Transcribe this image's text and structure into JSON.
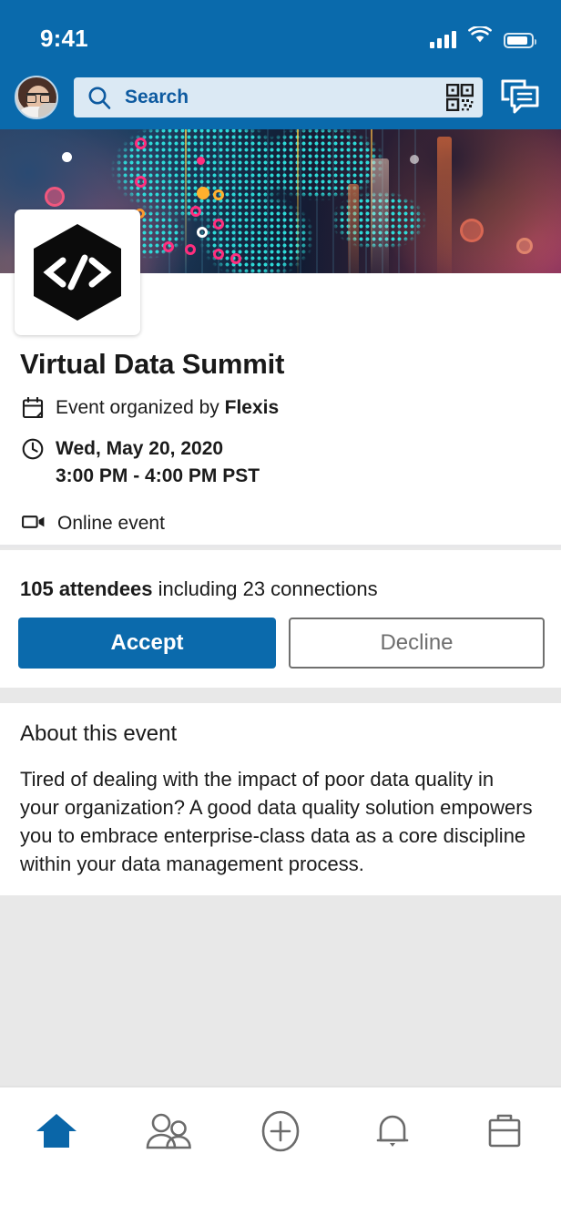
{
  "status_bar": {
    "time": "9:41",
    "signal_icon": "cellular-signal-icon",
    "wifi_icon": "wifi-icon",
    "battery_icon": "battery-icon"
  },
  "header": {
    "avatar_label": "profile-avatar",
    "search": {
      "placeholder": "Search",
      "search_icon": "search-icon",
      "qr_icon": "qr-code-icon"
    },
    "messaging_icon": "messaging-icon",
    "background_color": "#0a6aac"
  },
  "banner": {
    "alt": "data visualization world map banner"
  },
  "organization": {
    "logo_glyph": "</>",
    "logo_name": "flexis-logo"
  },
  "event": {
    "title": "Virtual Data Summit",
    "organizer_prefix": "Event organized by ",
    "organizer": "Flexis",
    "date": "Wed, May 20, 2020",
    "time": "3:00 PM - 4:00 PM PST",
    "location": "Online event",
    "calendar_icon": "calendar-icon",
    "clock_icon": "clock-icon",
    "video_icon": "video-camera-icon"
  },
  "attendees": {
    "count_text": "105 attendees",
    "connections_text": " including 23 connections"
  },
  "actions": {
    "accept_label": "Accept",
    "decline_label": "Decline",
    "accept_color": "#0b6aac",
    "decline_border_color": "#70706f"
  },
  "about": {
    "heading": "About this event",
    "body": "Tired of dealing with the impact of poor data quality in your organization? A good data quality solution empowers you to embrace enterprise-class data as a core discipline within your data management process."
  },
  "bottom_nav": {
    "items": [
      {
        "name": "home",
        "icon": "home-icon",
        "active": true
      },
      {
        "name": "my-network",
        "icon": "people-icon",
        "active": false
      },
      {
        "name": "post",
        "icon": "plus-circle-icon",
        "active": false
      },
      {
        "name": "notifications",
        "icon": "bell-icon",
        "active": false
      },
      {
        "name": "jobs",
        "icon": "briefcase-icon",
        "active": false
      }
    ],
    "active_color": "#0a66a8",
    "inactive_color": "#6b6b6b"
  }
}
